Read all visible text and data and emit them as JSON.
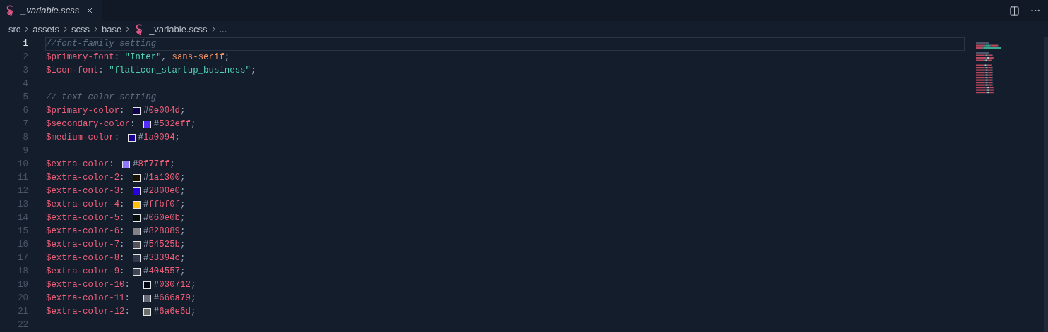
{
  "tab": {
    "label": "_variable.scss",
    "selected": true
  },
  "breadcrumb": [
    {
      "kind": "folder",
      "label": "src"
    },
    {
      "kind": "folder",
      "label": "assets"
    },
    {
      "kind": "folder",
      "label": "scss"
    },
    {
      "kind": "folder",
      "label": "base"
    },
    {
      "kind": "file",
      "label": "_variable.scss"
    },
    {
      "kind": "more",
      "label": "..."
    }
  ],
  "lines": [
    {
      "number": "1",
      "current": true,
      "tokens": [
        {
          "kind": "comment",
          "text": "//font-family setting"
        }
      ]
    },
    {
      "number": "2",
      "current": false,
      "tokens": [
        {
          "kind": "variable",
          "text": "$primary-font"
        },
        {
          "kind": "punct",
          "text": ": "
        },
        {
          "kind": "string",
          "text": "\"Inter\""
        },
        {
          "kind": "punct",
          "text": ", "
        },
        {
          "kind": "keyword",
          "text": "sans-serif"
        },
        {
          "kind": "punct",
          "text": ";"
        }
      ]
    },
    {
      "number": "3",
      "current": false,
      "tokens": [
        {
          "kind": "variable",
          "text": "$icon-font"
        },
        {
          "kind": "punct",
          "text": ": "
        },
        {
          "kind": "string",
          "text": "\"flaticon_startup_business\""
        },
        {
          "kind": "punct",
          "text": ";"
        }
      ]
    },
    {
      "number": "4",
      "current": false
    },
    {
      "number": "5",
      "current": false,
      "tokens": [
        {
          "kind": "comment",
          "text": "// text color setting"
        }
      ]
    },
    {
      "number": "6",
      "current": false,
      "tokens": [
        {
          "kind": "variable",
          "text": "$primary-color"
        },
        {
          "kind": "punct",
          "text": ": "
        },
        {
          "kind": "swatch",
          "color": "#0e004d"
        },
        {
          "kind": "punct",
          "text": "#"
        },
        {
          "kind": "number",
          "text": "0e004d"
        },
        {
          "kind": "punct",
          "text": ";"
        }
      ]
    },
    {
      "number": "7",
      "current": false,
      "tokens": [
        {
          "kind": "variable",
          "text": "$secondary-color"
        },
        {
          "kind": "punct",
          "text": ": "
        },
        {
          "kind": "swatch",
          "color": "#532eff"
        },
        {
          "kind": "punct",
          "text": "#"
        },
        {
          "kind": "number",
          "text": "532eff"
        },
        {
          "kind": "punct",
          "text": ";"
        }
      ]
    },
    {
      "number": "8",
      "current": false,
      "tokens": [
        {
          "kind": "variable",
          "text": "$medium-color"
        },
        {
          "kind": "punct",
          "text": ": "
        },
        {
          "kind": "swatch",
          "color": "#1a0094"
        },
        {
          "kind": "punct",
          "text": "#"
        },
        {
          "kind": "number",
          "text": "1a0094"
        },
        {
          "kind": "punct",
          "text": ";"
        }
      ]
    },
    {
      "number": "9",
      "current": false
    },
    {
      "number": "10",
      "current": false,
      "tokens": [
        {
          "kind": "variable",
          "text": "$extra-color"
        },
        {
          "kind": "punct",
          "text": ": "
        },
        {
          "kind": "swatch",
          "color": "#8f77ff"
        },
        {
          "kind": "punct",
          "text": "#"
        },
        {
          "kind": "number",
          "text": "8f77ff"
        },
        {
          "kind": "punct",
          "text": ";"
        }
      ]
    },
    {
      "number": "11",
      "current": false,
      "tokens": [
        {
          "kind": "variable",
          "text": "$extra-color-2"
        },
        {
          "kind": "punct",
          "text": ": "
        },
        {
          "kind": "swatch",
          "color": "#1a1300"
        },
        {
          "kind": "punct",
          "text": "#"
        },
        {
          "kind": "number",
          "text": "1a1300"
        },
        {
          "kind": "punct",
          "text": ";"
        }
      ]
    },
    {
      "number": "12",
      "current": false,
      "tokens": [
        {
          "kind": "variable",
          "text": "$extra-color-3"
        },
        {
          "kind": "punct",
          "text": ": "
        },
        {
          "kind": "swatch",
          "color": "#2800e0"
        },
        {
          "kind": "punct",
          "text": "#"
        },
        {
          "kind": "number",
          "text": "2800e0"
        },
        {
          "kind": "punct",
          "text": ";"
        }
      ]
    },
    {
      "number": "13",
      "current": false,
      "tokens": [
        {
          "kind": "variable",
          "text": "$extra-color-4"
        },
        {
          "kind": "punct",
          "text": ": "
        },
        {
          "kind": "swatch",
          "color": "#ffbf0f"
        },
        {
          "kind": "punct",
          "text": "#"
        },
        {
          "kind": "number",
          "text": "ffbf0f"
        },
        {
          "kind": "punct",
          "text": ";"
        }
      ]
    },
    {
      "number": "14",
      "current": false,
      "tokens": [
        {
          "kind": "variable",
          "text": "$extra-color-5"
        },
        {
          "kind": "punct",
          "text": ": "
        },
        {
          "kind": "swatch",
          "color": "#060e0b"
        },
        {
          "kind": "punct",
          "text": "#"
        },
        {
          "kind": "number",
          "text": "060e0b"
        },
        {
          "kind": "punct",
          "text": ";"
        }
      ]
    },
    {
      "number": "15",
      "current": false,
      "tokens": [
        {
          "kind": "variable",
          "text": "$extra-color-6"
        },
        {
          "kind": "punct",
          "text": ": "
        },
        {
          "kind": "swatch",
          "color": "#828089"
        },
        {
          "kind": "punct",
          "text": "#"
        },
        {
          "kind": "number",
          "text": "828089"
        },
        {
          "kind": "punct",
          "text": ";"
        }
      ]
    },
    {
      "number": "16",
      "current": false,
      "tokens": [
        {
          "kind": "variable",
          "text": "$extra-color-7"
        },
        {
          "kind": "punct",
          "text": ": "
        },
        {
          "kind": "swatch",
          "color": "#54525b"
        },
        {
          "kind": "punct",
          "text": "#"
        },
        {
          "kind": "number",
          "text": "54525b"
        },
        {
          "kind": "punct",
          "text": ";"
        }
      ]
    },
    {
      "number": "17",
      "current": false,
      "tokens": [
        {
          "kind": "variable",
          "text": "$extra-color-8"
        },
        {
          "kind": "punct",
          "text": ": "
        },
        {
          "kind": "swatch",
          "color": "#33394c"
        },
        {
          "kind": "punct",
          "text": "#"
        },
        {
          "kind": "number",
          "text": "33394c"
        },
        {
          "kind": "punct",
          "text": ";"
        }
      ]
    },
    {
      "number": "18",
      "current": false,
      "tokens": [
        {
          "kind": "variable",
          "text": "$extra-color-9"
        },
        {
          "kind": "punct",
          "text": ": "
        },
        {
          "kind": "swatch",
          "color": "#404557"
        },
        {
          "kind": "punct",
          "text": "#"
        },
        {
          "kind": "number",
          "text": "404557"
        },
        {
          "kind": "punct",
          "text": ";"
        }
      ]
    },
    {
      "number": "19",
      "current": false,
      "tokens": [
        {
          "kind": "variable",
          "text": "$extra-color-10"
        },
        {
          "kind": "punct",
          "text": ":  "
        },
        {
          "kind": "swatch",
          "color": "#030712"
        },
        {
          "kind": "punct",
          "text": "#"
        },
        {
          "kind": "number",
          "text": "030712"
        },
        {
          "kind": "punct",
          "text": ";"
        }
      ]
    },
    {
      "number": "20",
      "current": false,
      "tokens": [
        {
          "kind": "variable",
          "text": "$extra-color-11"
        },
        {
          "kind": "punct",
          "text": ":  "
        },
        {
          "kind": "swatch",
          "color": "#666a79"
        },
        {
          "kind": "punct",
          "text": "#"
        },
        {
          "kind": "number",
          "text": "666a79"
        },
        {
          "kind": "punct",
          "text": ";"
        }
      ]
    },
    {
      "number": "21",
      "current": false,
      "tokens": [
        {
          "kind": "variable",
          "text": "$extra-color-12"
        },
        {
          "kind": "punct",
          "text": ":  "
        },
        {
          "kind": "swatch",
          "color": "#6a6e6d"
        },
        {
          "kind": "punct",
          "text": "#"
        },
        {
          "kind": "number",
          "text": "6a6e6d"
        },
        {
          "kind": "punct",
          "text": ";"
        }
      ]
    },
    {
      "number": "22",
      "current": false
    }
  ]
}
